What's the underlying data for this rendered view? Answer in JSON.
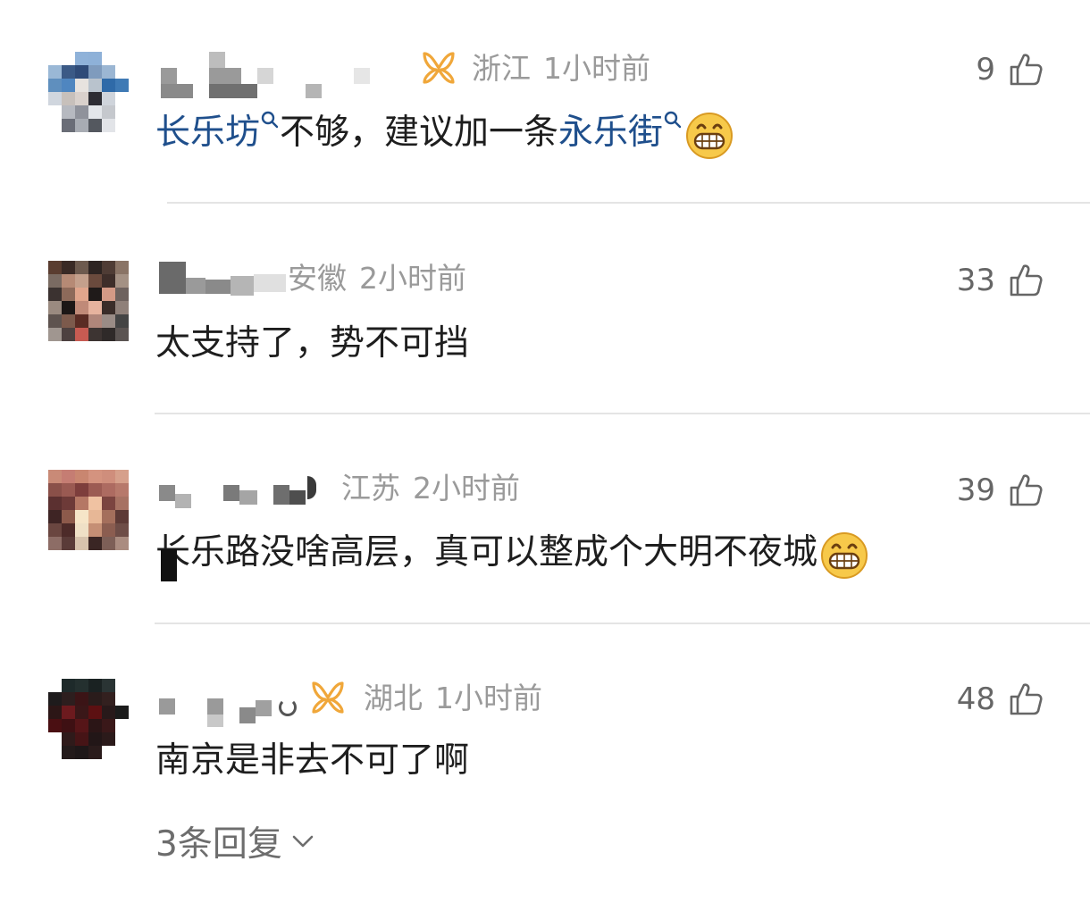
{
  "comments": [
    {
      "region": "浙江",
      "time": "1小时前",
      "likes": "9",
      "has_badge": true,
      "content_parts": [
        {
          "text": "长乐坊",
          "type": "topic"
        },
        {
          "text": "不够，建议加一条",
          "type": "text"
        },
        {
          "text": "永乐街",
          "type": "topic"
        }
      ],
      "trailing_emoji": "grin-emoji"
    },
    {
      "region": "安徽",
      "time": "2小时前",
      "likes": "33",
      "has_badge": false,
      "content": "太支持了，势不可挡"
    },
    {
      "region": "江苏",
      "time": "2小时前",
      "likes": "39",
      "has_badge": false,
      "content": "长乐路没啥高层，真可以整成个大明不夜城",
      "trailing_emoji": "grin-emoji"
    },
    {
      "region": "湖北",
      "time": "1小时前",
      "likes": "48",
      "has_badge": true,
      "content": "南京是非去不可了啊",
      "replies_label": "3条回复"
    }
  ],
  "icons": {
    "like": "thumbs-up-icon",
    "badge": "vip-badge-icon",
    "topic_search": "search-icon",
    "expand": "chevron-down-icon",
    "emoji": "grin-emoji"
  },
  "colors": {
    "topic_link": "#1f4f8c",
    "meta_text": "#9a9a9a",
    "badge": "#f0a73a",
    "divider": "#e4e4e4"
  }
}
